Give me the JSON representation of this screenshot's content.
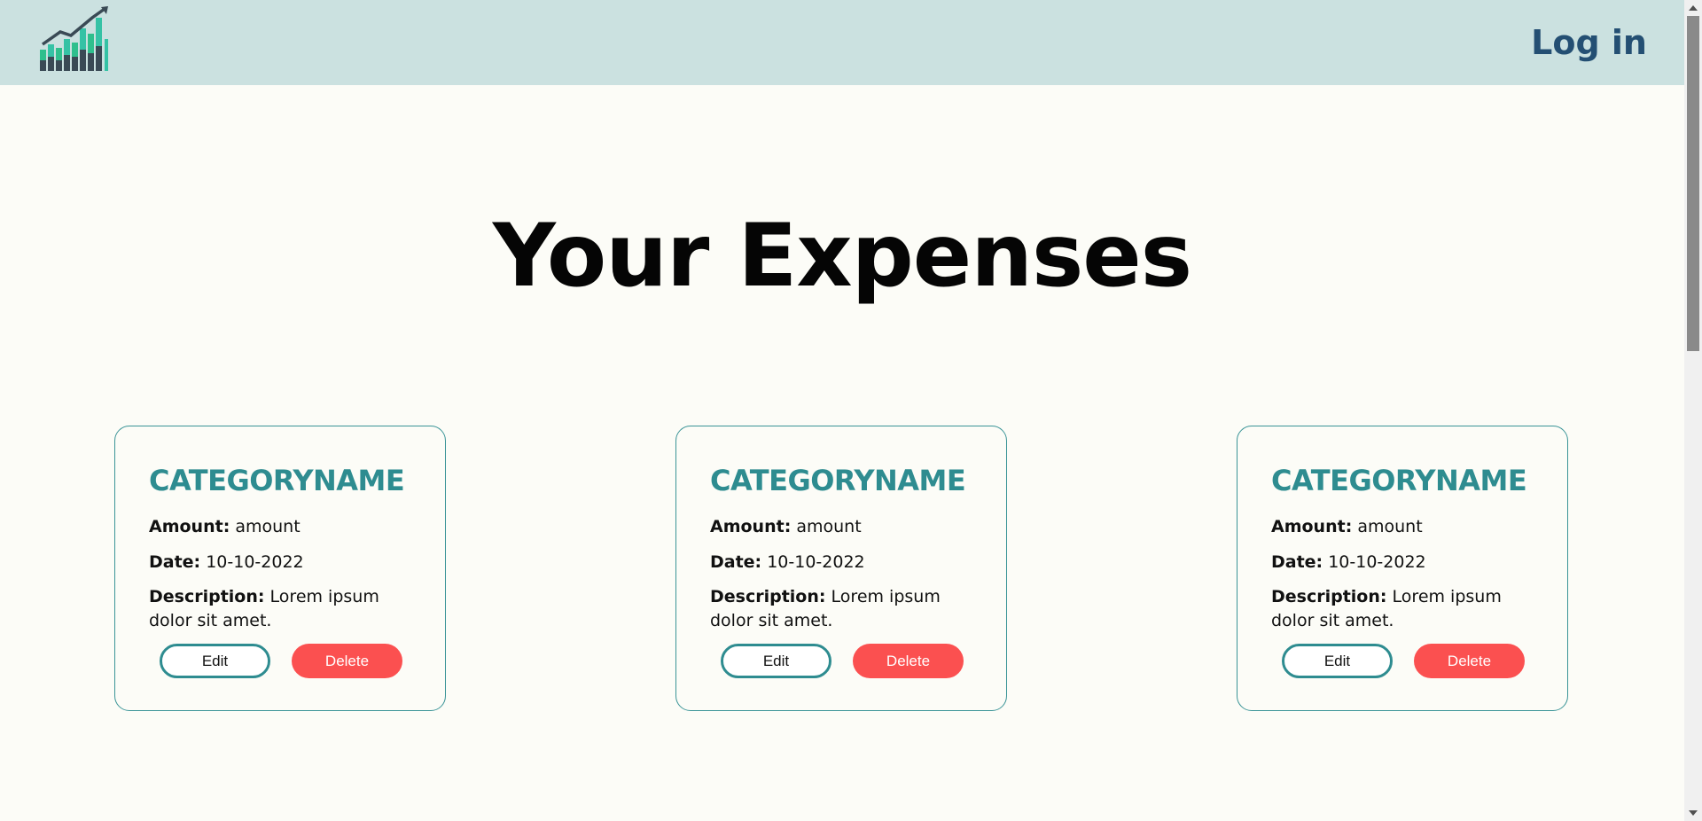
{
  "header": {
    "logo": "rising-bar-chart-logo",
    "login_label": "Log in"
  },
  "main": {
    "title": "Your Expenses"
  },
  "labels": {
    "amount": "Amount:",
    "date": "Date:",
    "description": "Description:",
    "edit": "Edit",
    "delete": "Delete"
  },
  "expenses": [
    {
      "category": "CATEGORYNAME",
      "amount": "amount",
      "date": "10-10-2022",
      "description": "Lorem ipsum dolor sit amet."
    },
    {
      "category": "CATEGORYNAME",
      "amount": "amount",
      "date": "10-10-2022",
      "description": "Lorem ipsum dolor sit amet."
    },
    {
      "category": "CATEGORYNAME",
      "amount": "amount",
      "date": "10-10-2022",
      "description": "Lorem ipsum dolor sit amet."
    }
  ],
  "colors": {
    "header_bg": "#cbe1e0",
    "accent": "#2e8c90",
    "login_text": "#244f73",
    "delete": "#fb5050",
    "page_bg": "#fcfcf7"
  }
}
